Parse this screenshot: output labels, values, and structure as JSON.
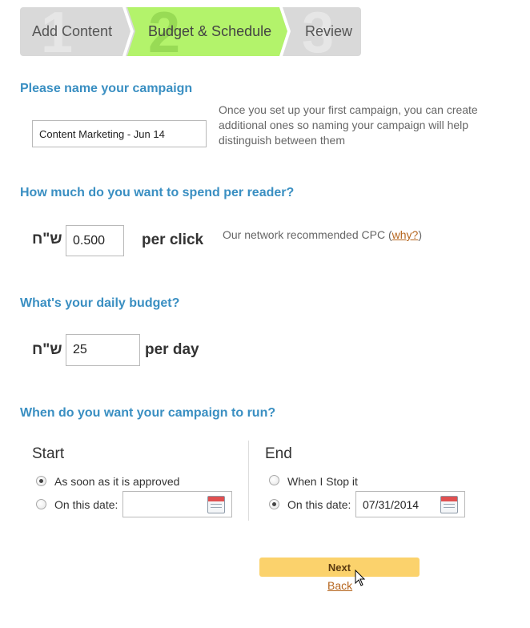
{
  "steps": [
    {
      "num": "1",
      "label": "Add Content"
    },
    {
      "num": "2",
      "label": "Budget & Schedule"
    },
    {
      "num": "3",
      "label": "Review"
    }
  ],
  "name_section": {
    "heading": "Please name your campaign",
    "value": "Content Marketing - Jun 14",
    "hint": "Once you set up your first campaign, you can create additional ones so naming your campaign will help distinguish between them"
  },
  "spend_section": {
    "heading": "How much do you want to spend per reader?",
    "currency": "ש\"ח",
    "value": "0.500",
    "unit": "per click",
    "hint_prefix": "Our network recommended CPC (",
    "hint_link": "why?",
    "hint_suffix": ")"
  },
  "budget_section": {
    "heading": "What's your daily budget?",
    "currency": "ש\"ח",
    "value": "25",
    "unit": "per day"
  },
  "schedule_section": {
    "heading": "When do you want your campaign to run?",
    "start": {
      "title": "Start",
      "option_approved": "As soon as it is approved",
      "option_date": "On this date:",
      "date_value": "",
      "selected": "approved"
    },
    "end": {
      "title": "End",
      "option_stop": "When I Stop it",
      "option_date": "On this date:",
      "date_value": "07/31/2014",
      "selected": "date"
    }
  },
  "actions": {
    "next_label": "Next",
    "back_label": "Back"
  },
  "colors": {
    "accent_heading": "#3a8fc2",
    "active_step": "#b3f36b",
    "next_button": "#fbd26c",
    "link": "#b5651d"
  }
}
